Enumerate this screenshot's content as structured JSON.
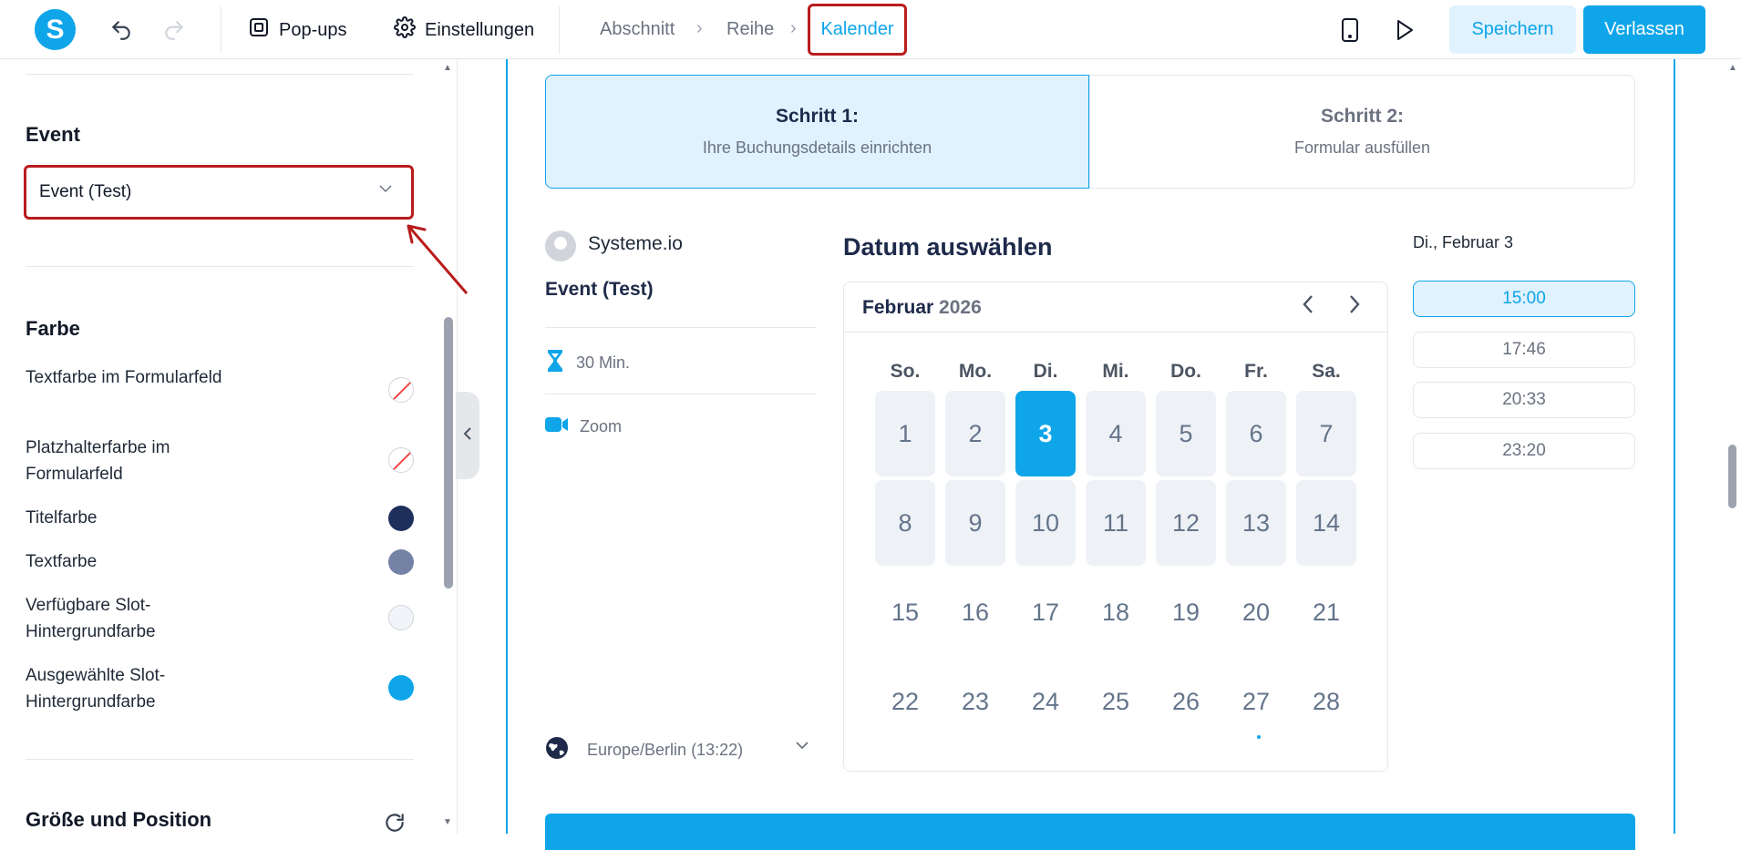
{
  "topbar": {
    "logo_letter": "S",
    "popups_label": "Pop-ups",
    "settings_label": "Einstellungen",
    "breadcrumb": [
      "Abschnitt",
      "Reihe",
      "Kalender"
    ],
    "save_label": "Speichern",
    "leave_label": "Verlassen"
  },
  "sidebar": {
    "event_title": "Event",
    "event_select_value": "Event (Test)",
    "color_title": "Farbe",
    "colors": [
      {
        "label": "Textfarbe im Formularfeld",
        "value": "none"
      },
      {
        "label": "Platzhalterfarbe im Formularfeld",
        "value": "none"
      },
      {
        "label": "Titelfarbe",
        "value": "#1e2f5c"
      },
      {
        "label": "Textfarbe",
        "value": "#7482a5"
      },
      {
        "label": "Verfügbare Slot-Hintergrundfarbe",
        "value": "#f1f4f8"
      },
      {
        "label": "Ausgewählte Slot-Hintergrundfarbe",
        "value": "#0ea5e9"
      }
    ],
    "size_title": "Größe und Position"
  },
  "booking": {
    "step1_title": "Schritt 1:",
    "step1_sub": "Ihre Buchungsdetails einrichten",
    "step2_title": "Schritt 2:",
    "step2_sub": "Formular ausfüllen",
    "host": "Systeme.io",
    "event_name": "Event (Test)",
    "duration": "30 Min.",
    "location": "Zoom",
    "timezone": "Europe/Berlin (13:22)"
  },
  "calendar": {
    "title": "Datum auswählen",
    "month": "Februar",
    "year": "2026",
    "weekdays": [
      "So.",
      "Mo.",
      "Di.",
      "Mi.",
      "Do.",
      "Fr.",
      "Sa."
    ],
    "days": [
      "1",
      "2",
      "3",
      "4",
      "5",
      "6",
      "7",
      "8",
      "9",
      "10",
      "11",
      "12",
      "13",
      "14",
      "15",
      "16",
      "17",
      "18",
      "19",
      "20",
      "21",
      "22",
      "23",
      "24",
      "25",
      "26",
      "27",
      "28"
    ],
    "selected_day": "3",
    "available_days": [
      "1",
      "2",
      "3",
      "4",
      "5",
      "6",
      "7",
      "8",
      "9",
      "10",
      "11",
      "12",
      "13",
      "14"
    ]
  },
  "slots": {
    "date_label": "Di., Februar 3",
    "times": [
      "15:00",
      "17:46",
      "20:33",
      "23:20"
    ],
    "selected": "15:00"
  },
  "colors": {
    "accent": "#0ea5e9",
    "annotation": "#b91c1c"
  }
}
